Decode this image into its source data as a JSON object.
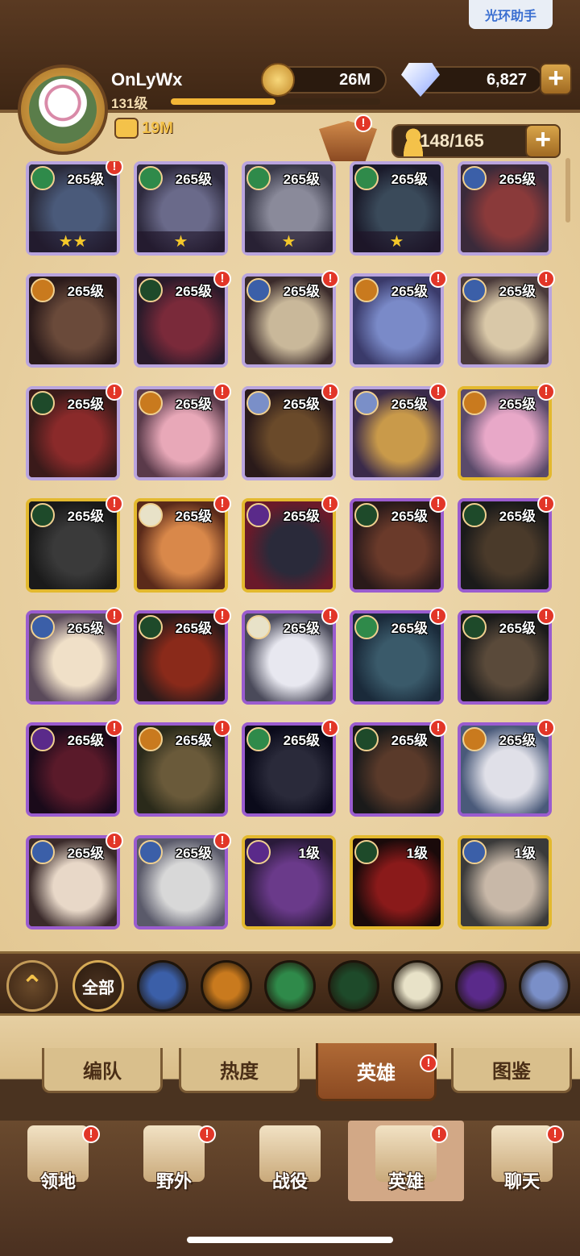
{
  "header": {
    "assist_button": "光环助手",
    "player_name": "OnLyWx",
    "player_level": "131级",
    "xp_progress": 0.5,
    "power": "19M",
    "gold": "26M",
    "gems": "6,827",
    "plus": "+"
  },
  "roster": {
    "hero_count": "148/165",
    "plus": "+"
  },
  "heroes": [
    {
      "level": "265级",
      "stars": "★★",
      "tier": "star",
      "faction": "wilder",
      "badge": "!"
    },
    {
      "level": "265级",
      "stars": "★",
      "tier": "star",
      "faction": "wilder",
      "badge": ""
    },
    {
      "level": "265级",
      "stars": "★",
      "tier": "star",
      "faction": "wilder",
      "badge": ""
    },
    {
      "level": "265级",
      "stars": "★",
      "tier": "star",
      "faction": "wilder",
      "badge": ""
    },
    {
      "level": "265级",
      "stars": "",
      "tier": "star",
      "faction": "lightbearer",
      "badge": ""
    },
    {
      "level": "265级",
      "stars": "",
      "tier": "star",
      "faction": "maulers",
      "badge": ""
    },
    {
      "level": "265级",
      "stars": "",
      "tier": "star",
      "faction": "graveborn",
      "badge": "!"
    },
    {
      "level": "265级",
      "stars": "",
      "tier": "star",
      "faction": "lightbearer",
      "badge": "!"
    },
    {
      "level": "265级",
      "stars": "",
      "tier": "star",
      "faction": "maulers",
      "badge": "!"
    },
    {
      "level": "265级",
      "stars": "",
      "tier": "star",
      "faction": "lightbearer",
      "badge": "!"
    },
    {
      "level": "265级",
      "stars": "",
      "tier": "star",
      "faction": "graveborn",
      "badge": "!"
    },
    {
      "level": "265级",
      "stars": "",
      "tier": "star",
      "faction": "maulers",
      "badge": "!"
    },
    {
      "level": "265级",
      "stars": "",
      "tier": "star",
      "faction": "dimensional",
      "badge": "!"
    },
    {
      "level": "265级",
      "stars": "",
      "tier": "star",
      "faction": "dimensional",
      "badge": "!"
    },
    {
      "level": "265级",
      "stars": "",
      "tier": "gold",
      "faction": "maulers",
      "badge": "!"
    },
    {
      "level": "265级",
      "stars": "",
      "tier": "gold",
      "faction": "graveborn",
      "badge": "!"
    },
    {
      "level": "265级",
      "stars": "",
      "tier": "gold",
      "faction": "celestial",
      "badge": "!"
    },
    {
      "level": "265级",
      "stars": "",
      "tier": "gold",
      "faction": "hypogean",
      "badge": "!"
    },
    {
      "level": "265级",
      "stars": "",
      "tier": "purple",
      "faction": "graveborn",
      "badge": "!"
    },
    {
      "level": "265级",
      "stars": "",
      "tier": "purple",
      "faction": "graveborn",
      "badge": "!"
    },
    {
      "level": "265级",
      "stars": "",
      "tier": "purple",
      "faction": "lightbearer",
      "badge": "!"
    },
    {
      "level": "265级",
      "stars": "",
      "tier": "purple",
      "faction": "graveborn",
      "badge": "!"
    },
    {
      "level": "265级",
      "stars": "",
      "tier": "purple",
      "faction": "celestial",
      "badge": "!"
    },
    {
      "level": "265级",
      "stars": "",
      "tier": "purple",
      "faction": "wilder",
      "badge": "!"
    },
    {
      "level": "265级",
      "stars": "",
      "tier": "purple",
      "faction": "graveborn",
      "badge": "!"
    },
    {
      "level": "265级",
      "stars": "",
      "tier": "purple",
      "faction": "hypogean",
      "badge": "!"
    },
    {
      "level": "265级",
      "stars": "",
      "tier": "purple",
      "faction": "maulers",
      "badge": "!"
    },
    {
      "level": "265级",
      "stars": "",
      "tier": "purple",
      "faction": "wilder",
      "badge": "!"
    },
    {
      "level": "265级",
      "stars": "",
      "tier": "purple",
      "faction": "graveborn",
      "badge": "!"
    },
    {
      "level": "265级",
      "stars": "",
      "tier": "purple",
      "faction": "maulers",
      "badge": "!"
    },
    {
      "level": "265级",
      "stars": "",
      "tier": "purple",
      "faction": "lightbearer",
      "badge": "!"
    },
    {
      "level": "265级",
      "stars": "",
      "tier": "purple",
      "faction": "lightbearer",
      "badge": "!"
    },
    {
      "level": "1级",
      "stars": "",
      "tier": "gold",
      "faction": "hypogean",
      "badge": ""
    },
    {
      "level": "1级",
      "stars": "",
      "tier": "gold",
      "faction": "graveborn",
      "badge": ""
    },
    {
      "level": "1级",
      "stars": "",
      "tier": "gold",
      "faction": "lightbearer",
      "badge": ""
    }
  ],
  "filters": {
    "all": "全部",
    "factions": [
      "lightbearer",
      "maulers",
      "wilder",
      "graveborn",
      "celestial",
      "hypogean",
      "dimensional"
    ]
  },
  "subtabs": [
    {
      "label": "编队",
      "active": false,
      "badge": ""
    },
    {
      "label": "热度",
      "active": false,
      "badge": ""
    },
    {
      "label": "英雄",
      "active": true,
      "badge": "!"
    },
    {
      "label": "图鉴",
      "active": false,
      "badge": ""
    }
  ],
  "nav": [
    {
      "label": "领地",
      "active": false,
      "badge": "!"
    },
    {
      "label": "野外",
      "active": false,
      "badge": "!"
    },
    {
      "label": "战役",
      "active": false,
      "badge": ""
    },
    {
      "label": "英雄",
      "active": true,
      "badge": "!"
    },
    {
      "label": "聊天",
      "active": false,
      "badge": "!"
    }
  ],
  "colors": {
    "lightbearer": "#3b5fa8",
    "maulers": "#c97a1e",
    "wilder": "#2f8a4a",
    "graveborn": "#1e4a2a",
    "celestial": "#e8e2c8",
    "hypogean": "#5a2a8a",
    "dimensional": "#7a8fc8",
    "badge_red": "#e23628"
  }
}
